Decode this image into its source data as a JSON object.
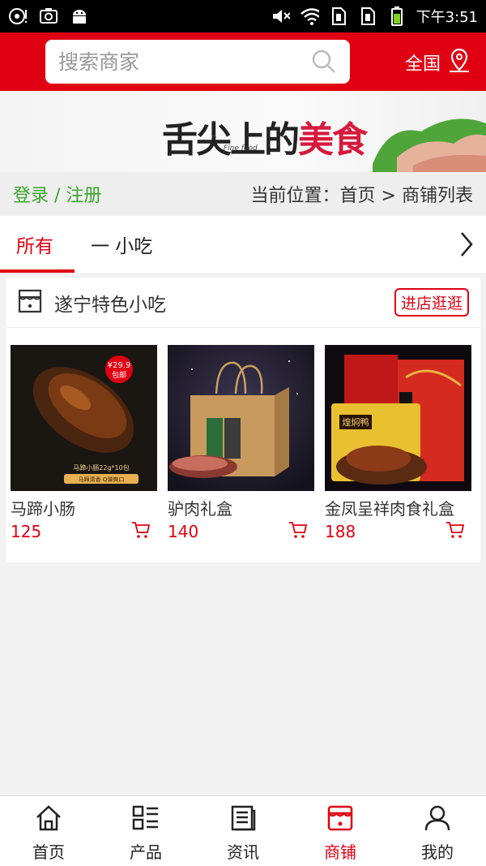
{
  "status_bar": {
    "time": "下午3:51",
    "icons": [
      "notification-icon",
      "screenshot-icon",
      "android-icon",
      "mute-icon",
      "wifi-icon",
      "sim1-icon",
      "sim2-icon",
      "battery-icon"
    ]
  },
  "header": {
    "search_placeholder": "搜索商家",
    "region_label": "全国",
    "brand_color": "#e10012"
  },
  "banner": {
    "title_part1": "舌尖上的",
    "title_part2": "美食",
    "subtitle": "Fine food"
  },
  "breadcrumb": {
    "login_label": "登录 / 注册",
    "location_label": "当前位置：",
    "home": "首页",
    "separator": ">",
    "current": "商铺列表"
  },
  "tabs": {
    "items": [
      {
        "label": "所有",
        "active": true
      },
      {
        "label": "一 小吃",
        "active": false
      }
    ]
  },
  "shop": {
    "name": "遂宁特色小吃",
    "visit_label": "进店逛逛",
    "products": [
      {
        "name": "马蹄小肠",
        "price": "125",
        "image_text": "马蹄小肠22g*10包",
        "badge_price": "¥29.9",
        "badge_sub": "包邮",
        "image_tags": "马蹄清香 Q弹爽口"
      },
      {
        "name": "驴肉礼盒",
        "price": "140"
      },
      {
        "name": "金凤呈祥肉食礼盒",
        "price": "188",
        "image_text": "煌焖鸭"
      }
    ]
  },
  "bottom_nav": {
    "items": [
      {
        "label": "首页",
        "icon": "home-icon"
      },
      {
        "label": "产品",
        "icon": "grid-list-icon"
      },
      {
        "label": "资讯",
        "icon": "news-icon"
      },
      {
        "label": "商铺",
        "icon": "shop-icon",
        "active": true
      },
      {
        "label": "我的",
        "icon": "user-icon"
      }
    ]
  }
}
